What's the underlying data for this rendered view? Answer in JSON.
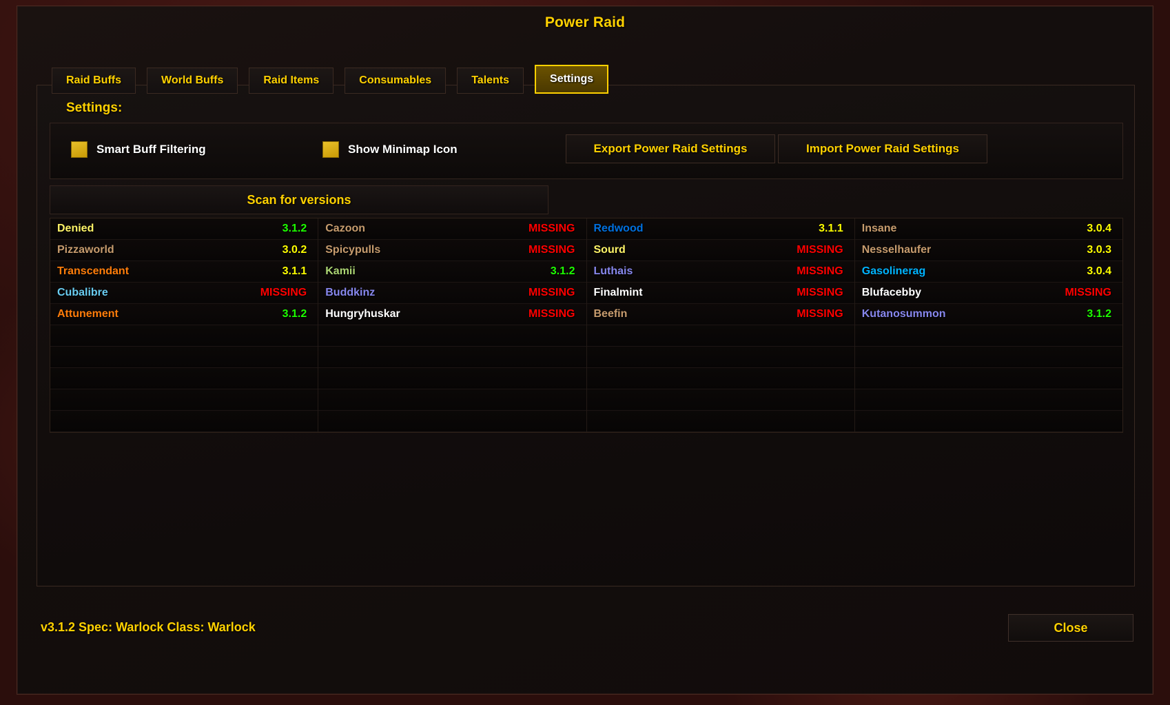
{
  "window": {
    "title": "Power Raid"
  },
  "tabs": [
    {
      "label": "Raid Buffs",
      "active": false
    },
    {
      "label": "World Buffs",
      "active": false
    },
    {
      "label": "Raid Items",
      "active": false
    },
    {
      "label": "Consumables",
      "active": false
    },
    {
      "label": "Talents",
      "active": false
    },
    {
      "label": "Settings",
      "active": true
    }
  ],
  "settings": {
    "heading": "Settings:",
    "checkboxes": [
      {
        "label": "Smart Buff Filtering",
        "checked": true
      },
      {
        "label": "Show Minimap Icon",
        "checked": true
      }
    ],
    "export_label": "Export Power Raid Settings",
    "import_label": "Import Power Raid Settings",
    "scan_label": "Scan for versions"
  },
  "version_table": {
    "empty_row_count": 5,
    "columns": [
      {
        "rows": [
          {
            "name": "Denied",
            "name_color": "#fff468",
            "version": "3.1.2",
            "version_color": "#1eff00"
          },
          {
            "name": "Pizzaworld",
            "name_color": "#c79c6e",
            "version": "3.0.2",
            "version_color": "#ffff00"
          },
          {
            "name": "Transcendant",
            "name_color": "#ff7d0a",
            "version": "3.1.1",
            "version_color": "#ffff00"
          },
          {
            "name": "Cubalibre",
            "name_color": "#69ccf0",
            "version": "MISSING",
            "version_color": "#ff0000"
          },
          {
            "name": "Attunement",
            "name_color": "#ff7d0a",
            "version": "3.1.2",
            "version_color": "#1eff00"
          }
        ]
      },
      {
        "rows": [
          {
            "name": "Cazoon",
            "name_color": "#c79c6e",
            "version": "MISSING",
            "version_color": "#ff0000"
          },
          {
            "name": "Spicypulls",
            "name_color": "#c79c6e",
            "version": "MISSING",
            "version_color": "#ff0000"
          },
          {
            "name": "Kamii",
            "name_color": "#abd473",
            "version": "3.1.2",
            "version_color": "#1eff00"
          },
          {
            "name": "Buddkinz",
            "name_color": "#8787ed",
            "version": "MISSING",
            "version_color": "#ff0000"
          },
          {
            "name": "Hungryhuskar",
            "name_color": "#ffffff",
            "version": "MISSING",
            "version_color": "#ff0000"
          }
        ]
      },
      {
        "rows": [
          {
            "name": "Redwood",
            "name_color": "#0070de",
            "version": "3.1.1",
            "version_color": "#ffff00"
          },
          {
            "name": "Sourd",
            "name_color": "#fff468",
            "version": "MISSING",
            "version_color": "#ff0000"
          },
          {
            "name": "Luthais",
            "name_color": "#8787ed",
            "version": "MISSING",
            "version_color": "#ff0000"
          },
          {
            "name": "Finalmint",
            "name_color": "#ffffff",
            "version": "MISSING",
            "version_color": "#ff0000"
          },
          {
            "name": "Beefin",
            "name_color": "#c79c6e",
            "version": "MISSING",
            "version_color": "#ff0000"
          }
        ]
      },
      {
        "rows": [
          {
            "name": "Insane",
            "name_color": "#c79c6e",
            "version": "3.0.4",
            "version_color": "#ffff00"
          },
          {
            "name": "Nesselhaufer",
            "name_color": "#c79c6e",
            "version": "3.0.3",
            "version_color": "#ffff00"
          },
          {
            "name": "Gasolinerag",
            "name_color": "#00b4ff",
            "version": "3.0.4",
            "version_color": "#ffff00"
          },
          {
            "name": "Blufacebby",
            "name_color": "#ffffff",
            "version": "MISSING",
            "version_color": "#ff0000"
          },
          {
            "name": "Kutanosummon",
            "name_color": "#8787ed",
            "version": "3.1.2",
            "version_color": "#1eff00"
          }
        ]
      }
    ]
  },
  "footer": {
    "status": "v3.1.2  Spec: Warlock  Class: Warlock",
    "close_label": "Close"
  },
  "theme": {
    "accent_gold": "#ffd100",
    "missing_red": "#ff0000",
    "ok_green": "#1eff00",
    "old_yellow": "#ffff00"
  }
}
